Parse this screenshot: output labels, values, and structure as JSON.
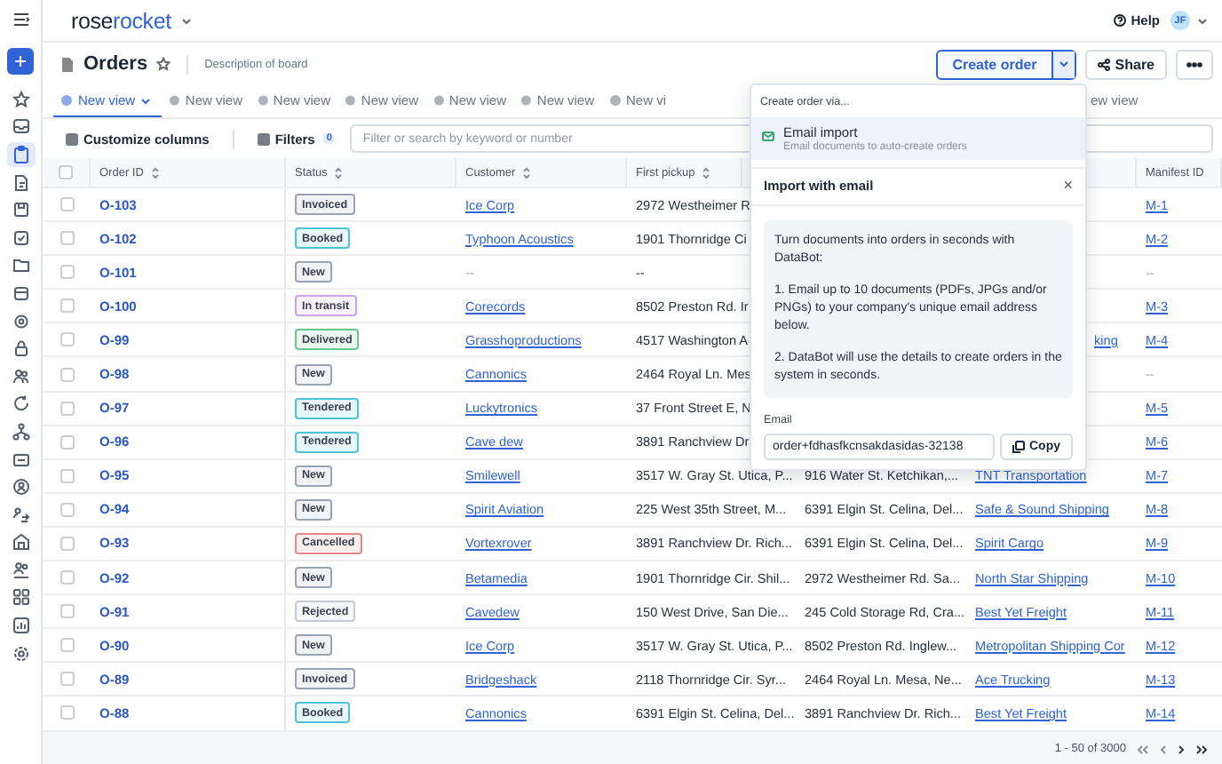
{
  "app": {
    "logo_left": "rose",
    "logo_right": "rocket",
    "help": "Help",
    "avatar": "JF"
  },
  "sidebar": {
    "items": [
      {
        "selected": false
      },
      {
        "selected": false
      },
      {
        "selected": true
      },
      {
        "selected": false
      },
      {
        "selected": false
      },
      {
        "selected": false
      },
      {
        "selected": false
      },
      {
        "selected": false
      },
      {
        "selected": false
      },
      {
        "selected": false
      },
      {
        "selected": false
      },
      {
        "selected": false
      },
      {
        "selected": false
      },
      {
        "selected": false
      },
      {
        "selected": false
      },
      {
        "selected": false
      },
      {
        "selected": false
      },
      {
        "selected": false
      },
      {
        "selected": false
      },
      {
        "selected": false
      },
      {
        "selected": false
      }
    ]
  },
  "board": {
    "title": "Orders",
    "description": "Description of board",
    "create_button": "Create order",
    "share_button": "Share"
  },
  "tabs": [
    {
      "label": "New view",
      "selected": true
    },
    {
      "label": "New view",
      "selected": false
    },
    {
      "label": "New view",
      "selected": false
    },
    {
      "label": "New view",
      "selected": false
    },
    {
      "label": "New view",
      "selected": false
    },
    {
      "label": "New view",
      "selected": false
    },
    {
      "label": "New vi",
      "selected": false
    },
    {
      "label": "ew view",
      "selected": false
    }
  ],
  "toolbar": {
    "customize": "Customize columns",
    "filters": "Filters",
    "filter_count": "0",
    "search_placeholder": "Filter or search by keyword or number"
  },
  "table": {
    "all_checked": false,
    "columns": {
      "order_id": "Order ID",
      "status": "Status",
      "customer": "Customer",
      "first_pickup": "First pickup",
      "manifest_id": "Manifest ID"
    },
    "rows": [
      {
        "checked": false,
        "order_id": "O-103",
        "status": {
          "text": "Invoiced",
          "color": "#9aa3b2"
        },
        "customer": {
          "text": "Ice Corp",
          "link": true
        },
        "first_pickup": "2972 Westheimer R",
        "manifest_id": {
          "text": "M-1",
          "link": true
        }
      },
      {
        "checked": false,
        "order_id": "O-102",
        "status": {
          "text": "Booked",
          "color": "#4cc3d9"
        },
        "customer": {
          "text": "Typhoon Acoustics",
          "link": true
        },
        "first_pickup": "1901 Thornridge Ci",
        "manifest_id": {
          "text": "M-2",
          "link": true
        }
      },
      {
        "checked": false,
        "order_id": "O-101",
        "status": {
          "text": "New",
          "color": "#9aa3b2"
        },
        "customer": {
          "text": "--",
          "link": false
        },
        "first_pickup": "--",
        "manifest_id": {
          "text": "--",
          "link": false
        }
      },
      {
        "checked": false,
        "order_id": "O-100",
        "status": {
          "text": "In transit",
          "color": "#c9a3e6"
        },
        "customer": {
          "text": "Corecords",
          "link": true
        },
        "first_pickup": "8502 Preston Rd. Ir",
        "manifest_id": {
          "text": "M-3",
          "link": true
        }
      },
      {
        "checked": false,
        "order_id": "O-99",
        "status": {
          "text": "Delivered",
          "color": "#6cc48a"
        },
        "customer": {
          "text": "Grasshoproductions",
          "link": true
        },
        "first_pickup": "4517 Washington A",
        "column_7": {
          "text": "king",
          "link": true
        },
        "manifest_id": {
          "text": "M-4",
          "link": true
        }
      },
      {
        "checked": false,
        "order_id": "O-98",
        "status": {
          "text": "New",
          "color": "#9aa3b2"
        },
        "customer": {
          "text": "Cannonics",
          "link": true
        },
        "first_pickup": "2464 Royal Ln. Mes",
        "manifest_id": {
          "text": "--",
          "link": false
        }
      },
      {
        "checked": false,
        "order_id": "O-97",
        "status": {
          "text": "Tendered",
          "color": "#4cc3d9"
        },
        "customer": {
          "text": "Luckytronics",
          "link": true
        },
        "first_pickup": "37 Front Street E, N",
        "manifest_id": {
          "text": "M-5",
          "link": true
        }
      },
      {
        "checked": false,
        "order_id": "O-96",
        "status": {
          "text": "Tendered",
          "color": "#4cc3d9"
        },
        "customer": {
          "text": "Cave dew",
          "link": true
        },
        "first_pickup": "3891 Ranchview Dr",
        "manifest_id": {
          "text": "M-6",
          "link": true
        }
      },
      {
        "checked": false,
        "order_id": "O-95",
        "status": {
          "text": "New",
          "color": "#9aa3b2"
        },
        "customer": {
          "text": "Smilewell",
          "link": true
        },
        "first_pickup": "3517 W. Gray St. Utica, P...",
        "column_6": "916 Water St. Ketchikan,...",
        "column_7": {
          "text": "TNT Transportation",
          "link": true
        },
        "manifest_id": {
          "text": "M-7",
          "link": true
        }
      },
      {
        "checked": false,
        "order_id": "O-94",
        "status": {
          "text": "New",
          "color": "#9aa3b2"
        },
        "customer": {
          "text": "Spirit Aviation",
          "link": true
        },
        "first_pickup": "225 West 35th Street, M...",
        "column_6": "6391 Elgin St. Celina, Del...",
        "column_7": {
          "text": "Safe & Sound Shipping",
          "link": true
        },
        "manifest_id": {
          "text": "M-8",
          "link": true
        }
      },
      {
        "checked": false,
        "order_id": "O-93",
        "status": {
          "text": "Cancelled",
          "color": "#e58a8a"
        },
        "customer": {
          "text": "Vortexrover",
          "link": true
        },
        "first_pickup": "3891 Ranchview Dr. Rich...",
        "column_6": "6391 Elgin St. Celina, Del...",
        "column_7": {
          "text": "Spirit Cargo",
          "link": true
        },
        "manifest_id": {
          "text": "M-9",
          "link": true
        }
      },
      {
        "checked": false,
        "order_id": "O-92",
        "status": {
          "text": "New",
          "color": "#9aa3b2"
        },
        "customer": {
          "text": "Betamedia",
          "link": true
        },
        "first_pickup": "1901 Thornridge Cir. Shil...",
        "column_6": "2972 Westheimer Rd. Sa...",
        "column_7": {
          "text": "North Star Shipping",
          "link": true
        },
        "manifest_id": {
          "text": "M-10",
          "link": true
        }
      },
      {
        "checked": false,
        "order_id": "O-91",
        "status": {
          "text": "Rejected",
          "color": "#c4c9d2"
        },
        "customer": {
          "text": "Cavedew",
          "link": true
        },
        "first_pickup": "150 West Drive, San Die...",
        "column_6": "245 Cold Storage Rd, Cra...",
        "column_7": {
          "text": "Best Yet Freight",
          "link": true
        },
        "manifest_id": {
          "text": "M-11",
          "link": true
        }
      },
      {
        "checked": false,
        "order_id": "O-90",
        "status": {
          "text": "New",
          "color": "#9aa3b2"
        },
        "customer": {
          "text": "Ice Corp",
          "link": true
        },
        "first_pickup": "3517 W. Gray St. Utica, P...",
        "column_6": "8502 Preston Rd. Inglew...",
        "column_7": {
          "text": "Metropolitan Shipping Cor",
          "link": true
        },
        "manifest_id": {
          "text": "M-12",
          "link": true
        }
      },
      {
        "checked": false,
        "order_id": "O-89",
        "status": {
          "text": "Invoiced",
          "color": "#9aa3b2"
        },
        "customer": {
          "text": "Bridgeshack",
          "link": true
        },
        "first_pickup": "2118 Thornridge Cir. Syr...",
        "column_6": "2464 Royal Ln. Mesa, Ne...",
        "column_7": {
          "text": "Ace Trucking",
          "link": true
        },
        "manifest_id": {
          "text": "M-13",
          "link": true
        }
      },
      {
        "checked": false,
        "order_id": "O-88",
        "status": {
          "text": "Booked",
          "color": "#4cc3d9"
        },
        "customer": {
          "text": "Cannonics",
          "link": true
        },
        "first_pickup": "6391 Elgin St. Celina, Del...",
        "column_6": "3891 Ranchview Dr. Rich...",
        "column_7": {
          "text": "Best Yet Freight",
          "link": true
        },
        "manifest_id": {
          "text": "M-14",
          "link": true
        }
      }
    ]
  },
  "footer": {
    "range": "1 - 50 of 3000"
  },
  "popup": {
    "menu_title": "Create order via...",
    "item": {
      "title": "Email import",
      "subtitle": "Email documents to auto-create orders",
      "highlighted": true
    },
    "dialog": {
      "title": "Import with email",
      "close": "×",
      "paragraphs": [
        "Turn documents into orders in seconds with DataBot:",
        "1. Email up to 10 documents (PDFs, JPGs and/or PNGs) to your company's unique email address below.",
        "2. DataBot will use the details to create orders in the system in seconds."
      ],
      "email_label": "Email",
      "email_value": "order+fdhasfkcnsakdasidas-32138",
      "copy_button": "Copy"
    }
  }
}
